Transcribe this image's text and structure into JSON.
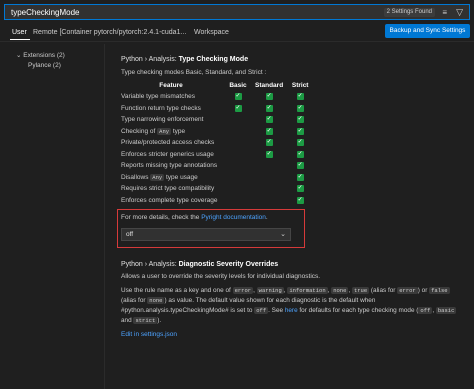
{
  "search": {
    "value": "typeCheckingMode",
    "results_badge": "2 Settings Found",
    "clear_filter_icon": "list-filter-lines-icon",
    "filter_icon": "funnel-icon"
  },
  "tabs": [
    {
      "label": "User"
    },
    {
      "label": "Remote [Container pytorch/pytorch:2.4.1-cuda1..."
    },
    {
      "label": "Workspace"
    }
  ],
  "backup_button": "Backup and Sync Settings",
  "tree": {
    "extensions": "Extensions (2)",
    "pylance": "Pylance (2)"
  },
  "setting1": {
    "prefix": "Python › Analysis: ",
    "name": "Type Checking Mode",
    "description": "Type checking modes Basic, Standard, and Strict :",
    "table": {
      "headers": [
        "Feature",
        "Basic",
        "Standard",
        "Strict"
      ],
      "rows": [
        {
          "feature": "Variable type mismatches",
          "basic": true,
          "standard": true,
          "strict": true
        },
        {
          "feature": "Function return type checks",
          "basic": true,
          "standard": true,
          "strict": true
        },
        {
          "feature": "Type narrowing enforcement",
          "basic": false,
          "standard": true,
          "strict": true
        },
        {
          "feature_pre": "Checking of ",
          "feature_code": "Any",
          "feature_post": " type",
          "basic": false,
          "standard": true,
          "strict": true
        },
        {
          "feature": "Private/protected access checks",
          "basic": false,
          "standard": true,
          "strict": true
        },
        {
          "feature": "Enforces stricter generics usage",
          "basic": false,
          "standard": true,
          "strict": true
        },
        {
          "feature": "Reports missing type annotations",
          "basic": false,
          "standard": false,
          "strict": true
        },
        {
          "feature_pre": "Disallows ",
          "feature_code": "Any",
          "feature_post": " type usage",
          "basic": false,
          "standard": false,
          "strict": true
        },
        {
          "feature": "Requires strict type compatibility",
          "basic": false,
          "standard": false,
          "strict": true
        },
        {
          "feature": "Enforces complete type coverage",
          "basic": false,
          "standard": false,
          "strict": true
        }
      ]
    },
    "details_pre": "For more details, check the ",
    "details_link": "Pyright documentation",
    "details_post": ".",
    "dropdown_value": "off"
  },
  "setting2": {
    "prefix": "Python › Analysis: ",
    "name": "Diagnostic Severity Overrides",
    "description": "Allows a user to override the severity levels for individual diagnostics.",
    "body": {
      "t1": "Use the rule name as a key and one of ",
      "c1": "error",
      "t2": ", ",
      "c2": "warning",
      "t3": ", ",
      "c3": "information",
      "t4": ", ",
      "c4": "none",
      "t5": ", ",
      "c5": "true",
      "t6": " (alias for ",
      "c6": "error",
      "t7": ") or ",
      "c7": "false",
      "t8": " (alias for ",
      "c8": "none",
      "t9": ") as value. The default value shown for each diagnostic is the default when #python.analysis.typeCheckingMode# is set to ",
      "c9": "off",
      "t10": ". See ",
      "link": "here",
      "t11": " for defaults for each type checking mode (",
      "c10": "off",
      "t12": ", ",
      "c11": "basic",
      "t13": " and ",
      "c12": "strict",
      "t14": ")."
    },
    "edit_link": "Edit in settings.json"
  },
  "colors": {
    "accent": "#0078d4",
    "check": "#1c9b44",
    "highlight_border": "#d63a3a",
    "link": "#4da3ff"
  }
}
